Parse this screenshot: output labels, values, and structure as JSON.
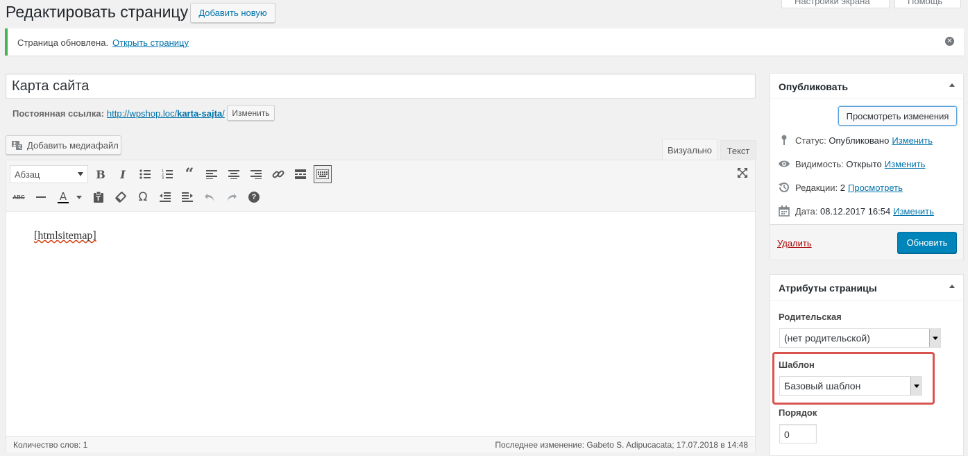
{
  "header": {
    "title": "Редактировать страницу",
    "add_new": "Добавить новую",
    "screen_options": "Настройки экрана",
    "help": "Помощь"
  },
  "notice": {
    "text": "Страница обновлена.",
    "link": "Открыть страницу"
  },
  "post": {
    "title": "Карта сайта",
    "permalink_label": "Постоянная ссылка:",
    "permalink_base": "http://wpshop.loc/",
    "permalink_slug": "karta-sajta",
    "permalink_end": "/",
    "permalink_edit": "Изменить"
  },
  "editor": {
    "add_media": "Добавить медиафайл",
    "tab_visual": "Визуально",
    "tab_text": "Текст",
    "format_select": "Абзац",
    "content": "[htmlsitemap]",
    "word_count": "Количество слов: 1",
    "last_edit": "Последнее изменение: Gabeto S. Adipucacata; 17.07.2018 в 14:48"
  },
  "publish": {
    "title": "Опубликовать",
    "preview": "Просмотреть изменения",
    "status_label": "Статус:",
    "status_value": "Опубликовано",
    "status_edit": "Изменить",
    "visibility_label": "Видимость:",
    "visibility_value": "Открыто",
    "visibility_edit": "Изменить",
    "revisions_label": "Редакции:",
    "revisions_value": "2",
    "revisions_link": "Просмотреть",
    "date_label": "Дата:",
    "date_value": "08.12.2017 16:54",
    "date_edit": "Изменить",
    "delete": "Удалить",
    "update": "Обновить"
  },
  "attributes": {
    "title": "Атрибуты страницы",
    "parent_label": "Родительская",
    "parent_value": "(нет родительской)",
    "template_label": "Шаблон",
    "template_value": "Базовый шаблон",
    "order_label": "Порядок",
    "order_value": "0"
  },
  "colors": {
    "accent": "#0073aa",
    "notice_success": "#46b450",
    "primary_button": "#0085ba",
    "highlight_box": "#d9534f",
    "delete_link": "#a00"
  }
}
